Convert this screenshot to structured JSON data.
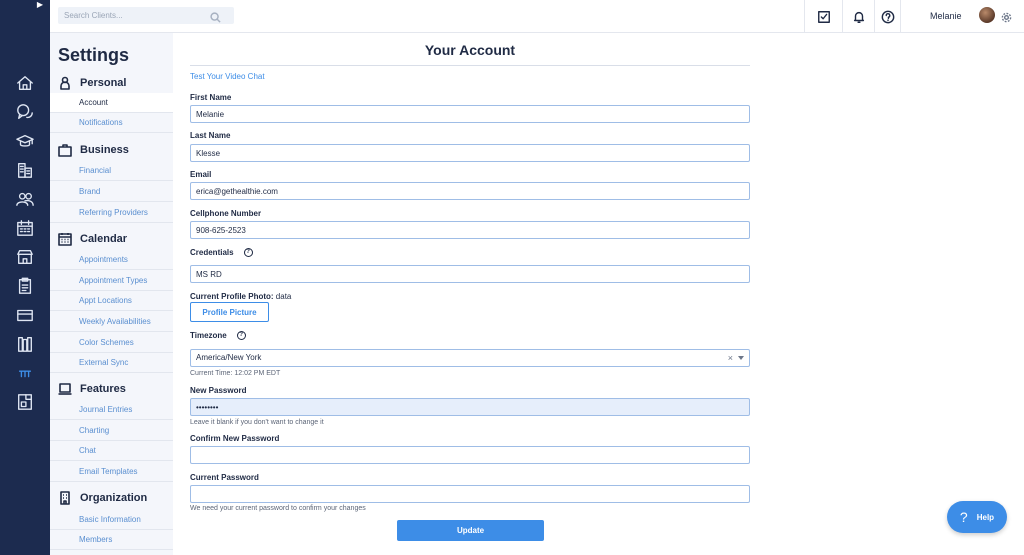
{
  "colors": {
    "rail": "#1c2b4f",
    "accent": "#3d8de7",
    "sidebar": "#f4f6fb",
    "text": "#1f2a44"
  },
  "rail": {
    "toggle_icon": "caret-right-icon",
    "icons": [
      "home-icon",
      "chat-icon",
      "graduation-cap-icon",
      "buildings-icon",
      "users-icon",
      "calendar-icon",
      "store-icon",
      "clipboard-icon",
      "credit-card-icon",
      "library-icon",
      "settings-bars-icon",
      "document-icon"
    ]
  },
  "topbar": {
    "search_placeholder": "Search Clients...",
    "icons": [
      "checkbox-icon",
      "bell-icon",
      "help-circle-icon"
    ],
    "user_name": "Melanie"
  },
  "sidebar": {
    "title": "Settings",
    "sections": [
      {
        "label": "Personal",
        "icon": "person-icon",
        "items": [
          "Account",
          "Notifications"
        ]
      },
      {
        "label": "Business",
        "icon": "briefcase-icon",
        "items": [
          "Financial",
          "Brand",
          "Referring Providers"
        ]
      },
      {
        "label": "Calendar",
        "icon": "calendar-icon",
        "items": [
          "Appointments",
          "Appointment Types",
          "Appt Locations",
          "Weekly Availabilities",
          "Color Schemes",
          "External Sync"
        ]
      },
      {
        "label": "Features",
        "icon": "laptop-icon",
        "items": [
          "Journal Entries",
          "Charting",
          "Chat",
          "Email Templates"
        ]
      },
      {
        "label": "Organization",
        "icon": "building-icon",
        "items": [
          "Basic Information",
          "Members"
        ]
      }
    ],
    "active_item": "Account"
  },
  "form": {
    "title": "Your Account",
    "video_link": "Test Your Video Chat",
    "first_name_label": "First Name",
    "first_name": "Melanie",
    "last_name_label": "Last Name",
    "last_name": "Klesse",
    "email_label": "Email",
    "email": "erica@gethealthie.com",
    "cell_label": "Cellphone Number",
    "cell": "908-625-2523",
    "credentials_label": "Credentials",
    "credentials": "MS RD",
    "photo_label": "Current Profile Photo:",
    "photo_value": "data",
    "profile_button": "Profile Picture",
    "timezone_label": "Timezone",
    "timezone": "America/New York",
    "current_time": "Current Time: 12:02 PM EDT",
    "new_password_label": "New Password",
    "new_password": "••••••••",
    "new_password_hint": "Leave it blank if you don't want to change it",
    "confirm_password_label": "Confirm New Password",
    "current_password_label": "Current Password",
    "current_password_hint": "We need your current password to confirm your changes",
    "update_button": "Update"
  },
  "help_button": "Help"
}
